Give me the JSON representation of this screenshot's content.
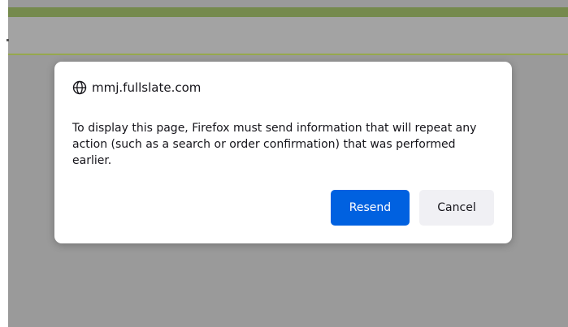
{
  "dialog": {
    "host": "mmj.fullslate.com",
    "host_icon": "globe-icon",
    "message": "To display this page, Firefox must send information that will repeat any action (such as a search or order confirmation) that was performed earlier.",
    "resend_label": "Resend",
    "cancel_label": "Cancel"
  },
  "colors": {
    "top_strip": "#758a4d",
    "header_line": "#96a84e",
    "overlay_bg": "#9a9a9a",
    "primary_button": "#0061e0",
    "secondary_button": "#f0f0f4"
  }
}
